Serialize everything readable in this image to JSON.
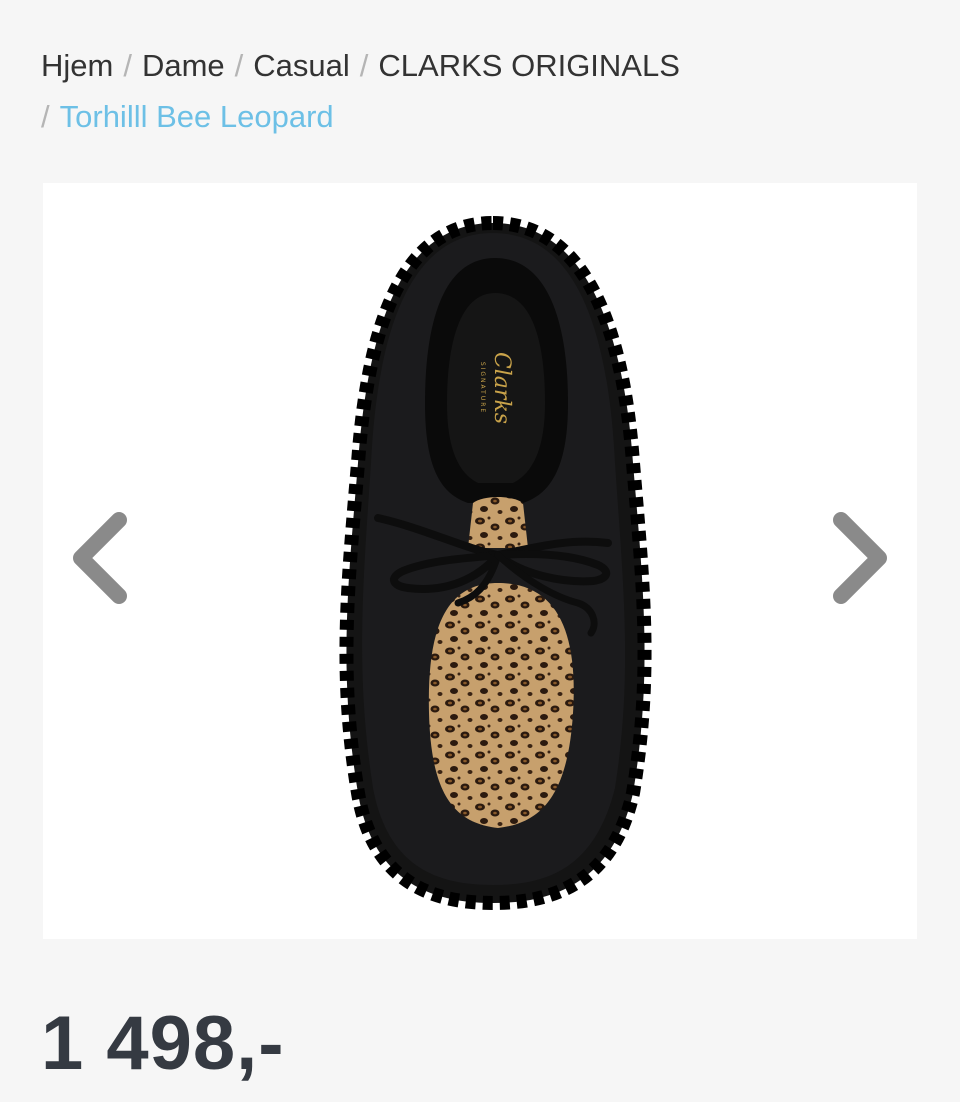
{
  "breadcrumb": {
    "separator": "/",
    "items": [
      "Hjem",
      "Dame",
      "Casual",
      "CLARKS ORIGINALS"
    ],
    "current": "Torhilll Bee Leopard"
  },
  "gallery": {
    "prev_icon": "chevron-left-icon",
    "next_icon": "chevron-right-icon",
    "arrow_color": "#8a8a8a",
    "image": {
      "brand_logo": "Clarks",
      "brand_sublogo": "SIGNATURE"
    }
  },
  "product": {
    "price": "1 498,-"
  },
  "colors": {
    "link": "#6dc0e6",
    "text": "#333333",
    "price": "#353a42",
    "background": "#f6f6f6"
  }
}
